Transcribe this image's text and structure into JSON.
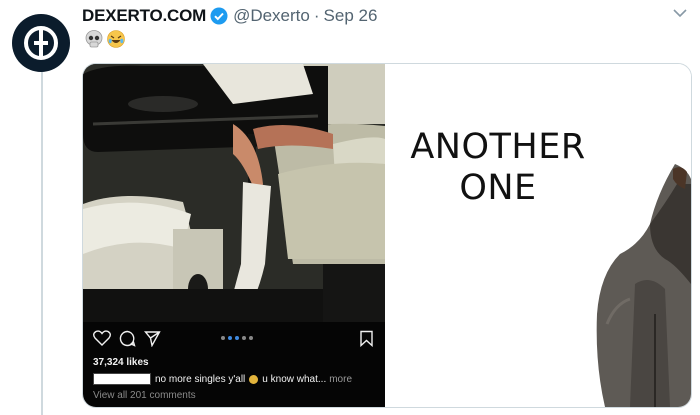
{
  "tweet": {
    "display_name": "DEXERTO.COM",
    "handle": "@Dexerto",
    "separator": "·",
    "date": "Sep 26",
    "emojis": [
      "skull-emoji",
      "rofl-emoji"
    ]
  },
  "instagram": {
    "likes": "37,324 likes",
    "caption": "no more singles y'all",
    "caption_rest": "u know what...",
    "more_label": "more",
    "comments": "View all 201 comments"
  },
  "meme": {
    "line1": "ANOTHER",
    "line2": "ONE"
  },
  "colors": {
    "avatar_bg": "#0b1c2c",
    "verified_blue": "#1d9bf0",
    "muted_text": "#536471",
    "ig_dot_active": "#3f8ae0"
  },
  "icons": [
    "chevron-down-icon",
    "verified-badge-icon",
    "heart-icon",
    "comment-icon",
    "share-icon",
    "bookmark-icon"
  ]
}
